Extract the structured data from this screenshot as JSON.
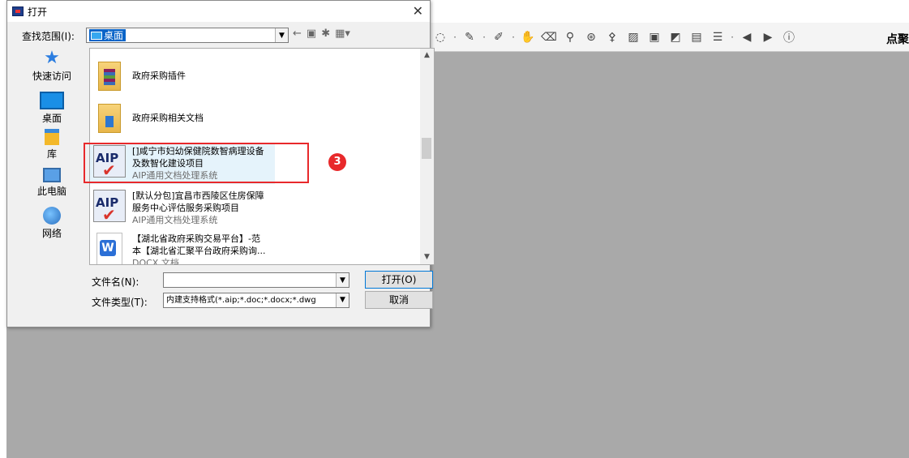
{
  "dialog": {
    "title": "打开",
    "close": "✕",
    "lookin_label": "查找范围(I):",
    "lookin_value": "桌面",
    "filename_label": "文件名(N):",
    "filename_value": "",
    "filetype_label": "文件类型(T):",
    "filetype_value": "内建支持格式(*.aip;*.doc;*.docx;*.dwg",
    "open_button": "打开(O)",
    "cancel_button": "取消"
  },
  "places": [
    {
      "label": "快速访问",
      "icon": "quick-access-icon"
    },
    {
      "label": "桌面",
      "icon": "desktop-icon"
    },
    {
      "label": "库",
      "icon": "library-icon"
    },
    {
      "label": "此电脑",
      "icon": "this-pc-icon"
    },
    {
      "label": "网络",
      "icon": "network-icon"
    }
  ],
  "files": [
    {
      "name": "政府采购插件",
      "line2": "",
      "type": "",
      "icon": "rar-folder-icon"
    },
    {
      "name": "政府采购相关文档",
      "line2": "",
      "type": "",
      "icon": "folder-icon"
    },
    {
      "name": "[]咸宁市妇幼保健院数智病理设备",
      "line2": "及数智化建设项目",
      "type": "AIP通用文档处理系统",
      "icon": "aip-icon"
    },
    {
      "name": "[默认分包]宜昌市西陵区住房保障",
      "line2": "服务中心评估服务采购项目",
      "type": "AIP通用文档处理系统",
      "icon": "aip-icon"
    },
    {
      "name": "【湖北省政府采购交易平台】-范",
      "line2": "本【湖北省汇聚平台政府采购询...",
      "type": "DOCX 文档",
      "icon": "docx-icon"
    }
  ],
  "annotation": {
    "badge": "3"
  },
  "app": {
    "toolbar_text": "点聚"
  },
  "colors": {
    "accent": "#e8292b",
    "selection": "#0a64c8",
    "workspace": "#a9a9a9"
  }
}
